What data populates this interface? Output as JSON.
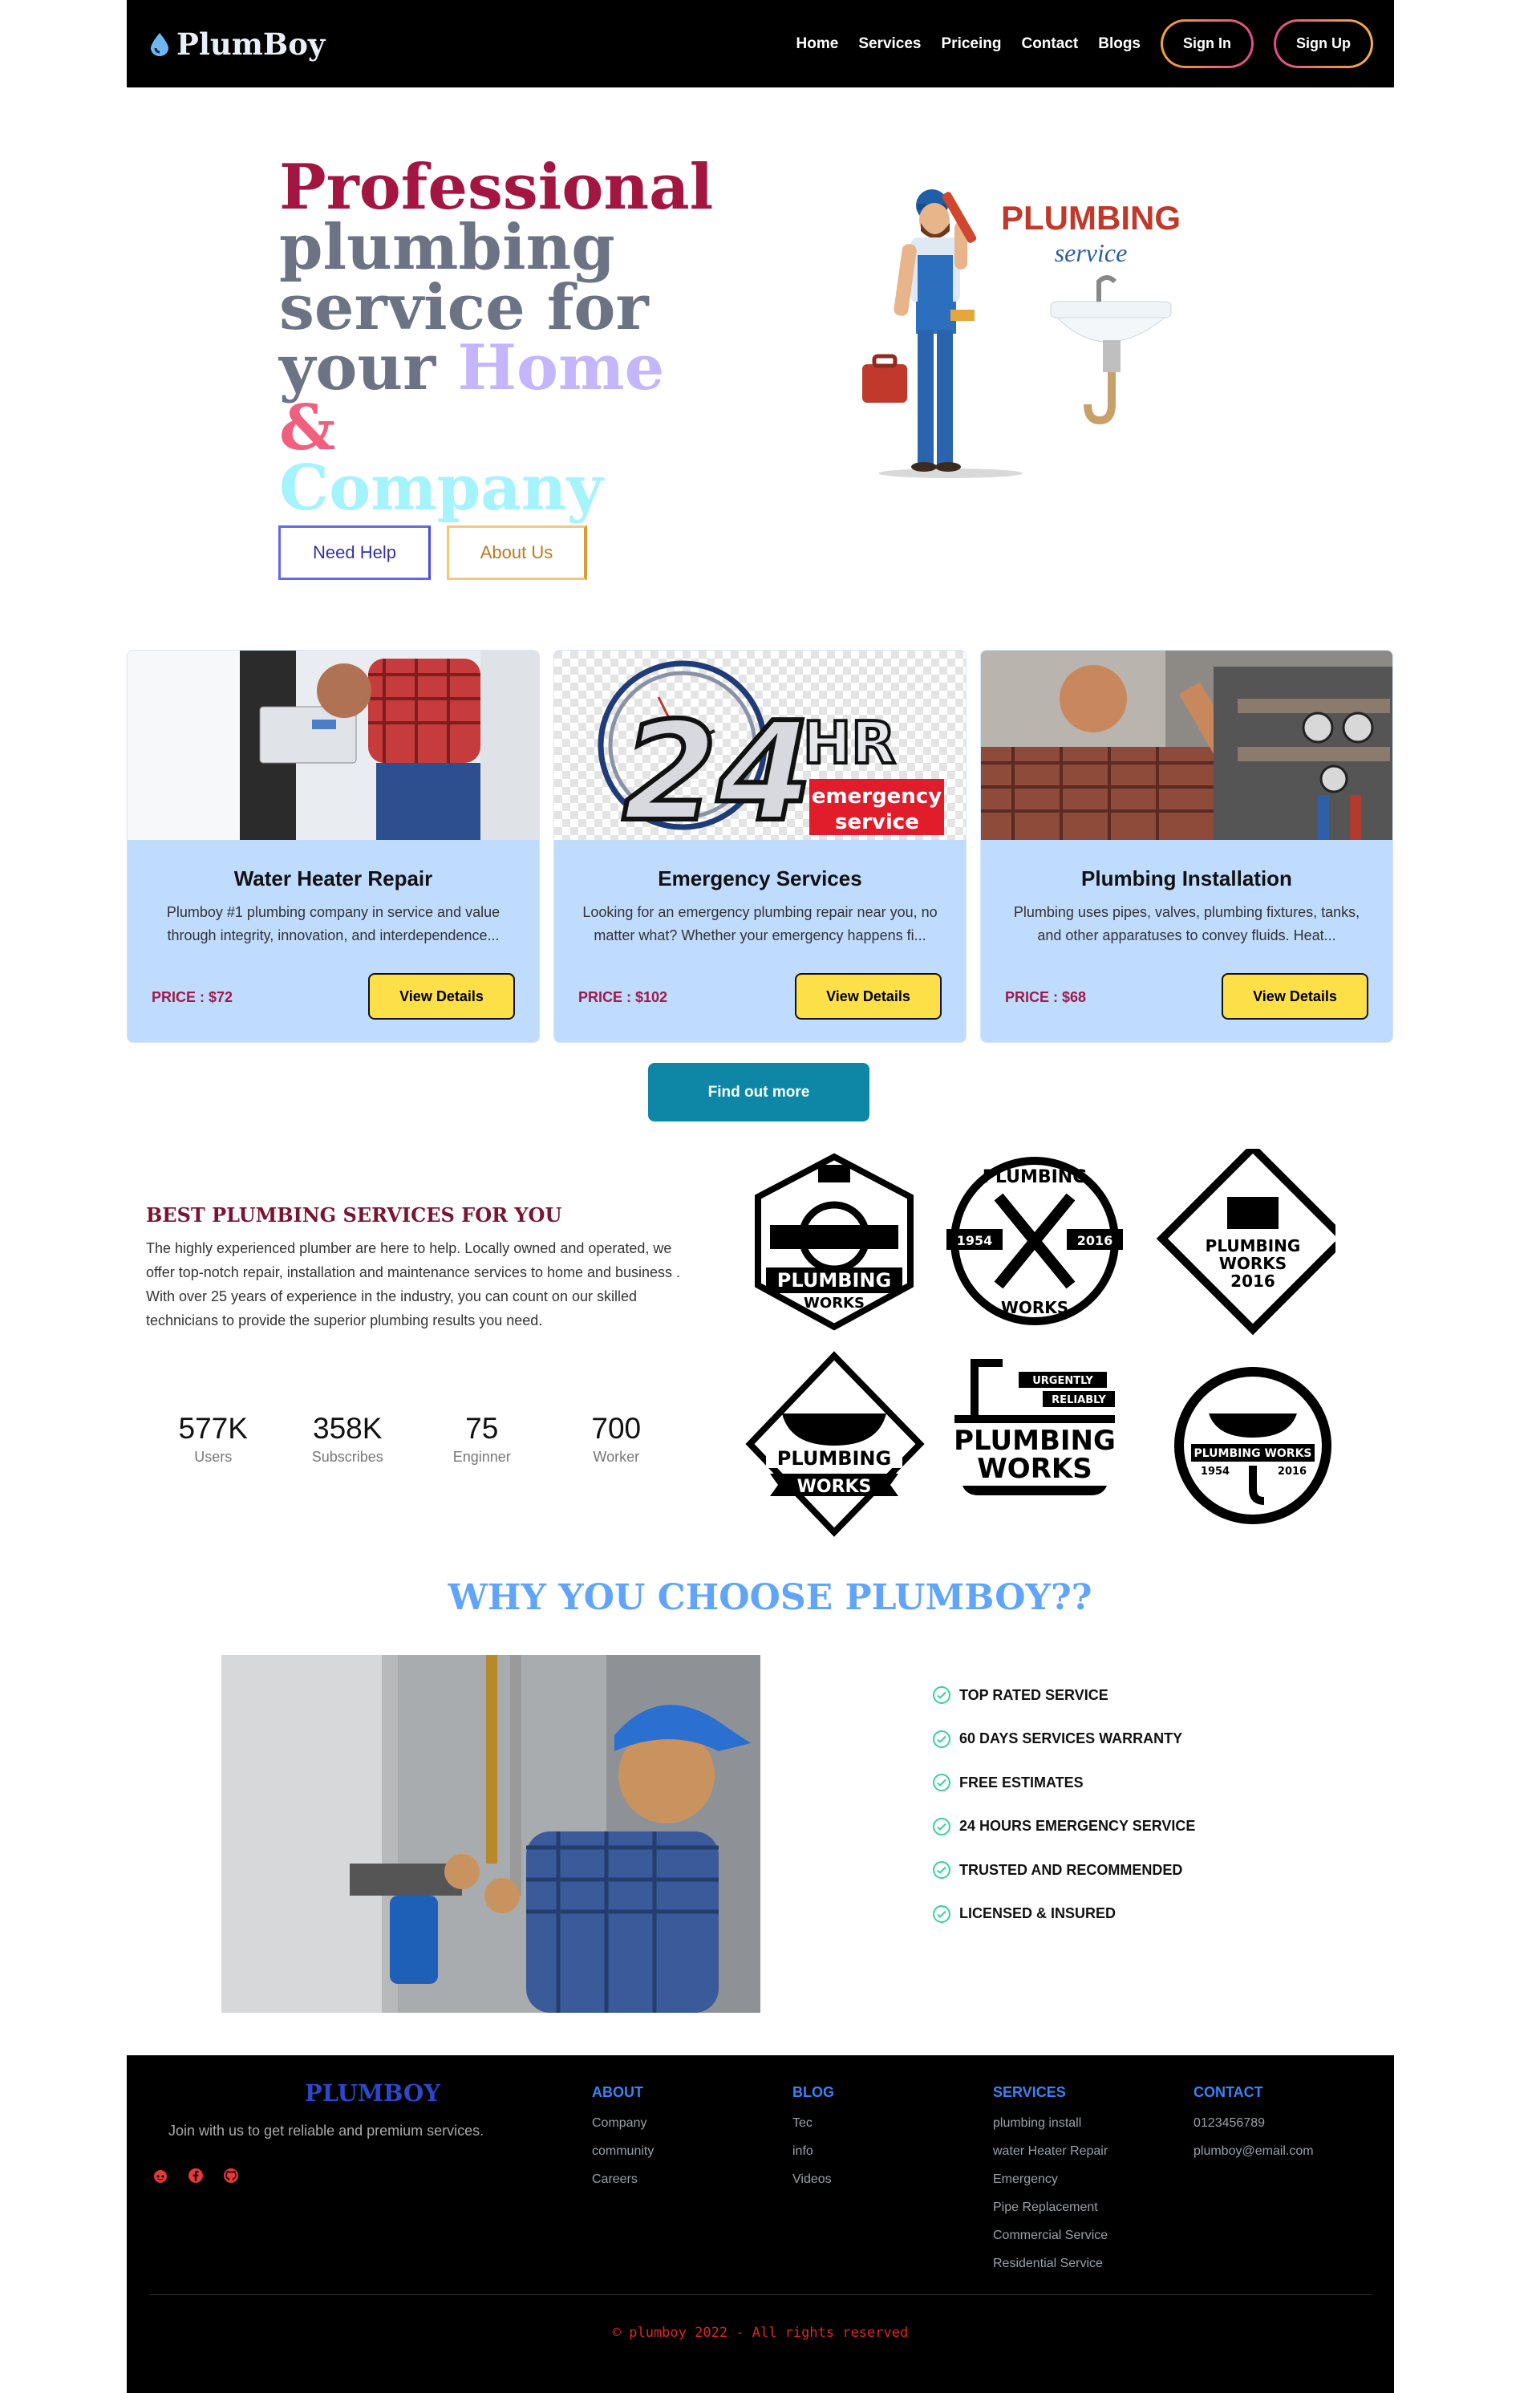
{
  "nav": {
    "brand": "PlumBoy",
    "links": [
      "Home",
      "Services",
      "Priceing",
      "Contact",
      "Blogs"
    ],
    "signin": "Sign In",
    "signup": "Sign Up"
  },
  "hero": {
    "line1": "Professional",
    "line2": "plumbing",
    "line3": "service for",
    "line4a": "your",
    "home": "Home",
    "amp": "&",
    "company": "Company",
    "btn_help": "Need Help",
    "btn_about": "About Us",
    "illus_title": "PLUMBING",
    "illus_sub": "service"
  },
  "cards": [
    {
      "title": "Water Heater Repair",
      "desc": "Plumboy #1 plumbing company in service and value through integrity, innovation, and interdependence...",
      "price": "PRICE : $72",
      "button": "View Details"
    },
    {
      "title": "Emergency Services",
      "desc": "Looking for an emergency plumbing repair near you, no matter what? Whether your emergency happens fi...",
      "price": "PRICE : $102",
      "button": "View Details",
      "img_big": "24",
      "img_hr": "HR",
      "img_tag1": "emergency",
      "img_tag2": "service"
    },
    {
      "title": "Plumbing Installation",
      "desc": "Plumbing uses pipes, valves, plumbing fixtures, tanks, and other apparatuses to convey fluids. Heat...",
      "price": "PRICE : $68",
      "button": "View Details"
    }
  ],
  "find_out": "Find out more",
  "best": {
    "title": "BEST PLUMBING SERVICES FOR YOU",
    "text": "The highly experienced plumber are here to help. Locally owned and operated, we offer top-notch repair, installation and maintenance services to home and business . With over 25 years of experience in the industry, you can count on our skilled technicians to provide the superior plumbing results you need.",
    "stats": [
      {
        "num": "577K",
        "label": "Users"
      },
      {
        "num": "358K",
        "label": "Subscribes"
      },
      {
        "num": "75",
        "label": "Enginner"
      },
      {
        "num": "700",
        "label": "Worker"
      }
    ],
    "badges": {
      "b1": [
        "PLUMBING",
        "WORKS"
      ],
      "b2": [
        "PLUMBING",
        "1954",
        "2016",
        "WORKS"
      ],
      "b3": [
        "PLUMBING",
        "WORKS",
        "2016"
      ],
      "b4": [
        "PLUMBING",
        "WORKS"
      ],
      "b5": [
        "URGENTLY",
        "RELIABLY",
        "PLUMBING",
        "WORKS"
      ],
      "b6": [
        "PLUMBING WORKS",
        "1954",
        "2016"
      ]
    }
  },
  "why": {
    "title": "WHY YOU CHOOSE PLUMBOY??",
    "items": [
      "TOP RATED SERVICE",
      "60 DAYS SERVICES WARRANTY",
      "FREE ESTIMATES",
      "24 HOURS EMERGENCY SERVICE",
      "TRUSTED AND RECOMMENDED",
      "LICENSED & INSURED"
    ]
  },
  "footer": {
    "brand": "PLUMBOY",
    "tagline": "Join with us to get reliable and premium services.",
    "columns": [
      {
        "title": "ABOUT",
        "items": [
          "Company",
          "community",
          "Careers"
        ]
      },
      {
        "title": "BLOG",
        "items": [
          "Tec",
          "info",
          "Videos"
        ]
      },
      {
        "title": "SERVICES",
        "items": [
          "plumbing install",
          "water Heater Repair",
          "Emergency",
          "Pipe Replacement",
          "Commercial Service",
          "Residential Service"
        ]
      },
      {
        "title": "CONTACT",
        "items": [
          "0123456789",
          "plumboy@email.com"
        ]
      }
    ],
    "copyright": "© plumboy 2022 - All rights reserved"
  },
  "colors": {
    "accent_red": "#a31641",
    "card_bg": "#bfdbfe",
    "button_yellow": "#fde047",
    "find_out_teal": "#0e87a6",
    "why_blue": "#60a5fa",
    "footer_blue": "#3b82f6"
  }
}
